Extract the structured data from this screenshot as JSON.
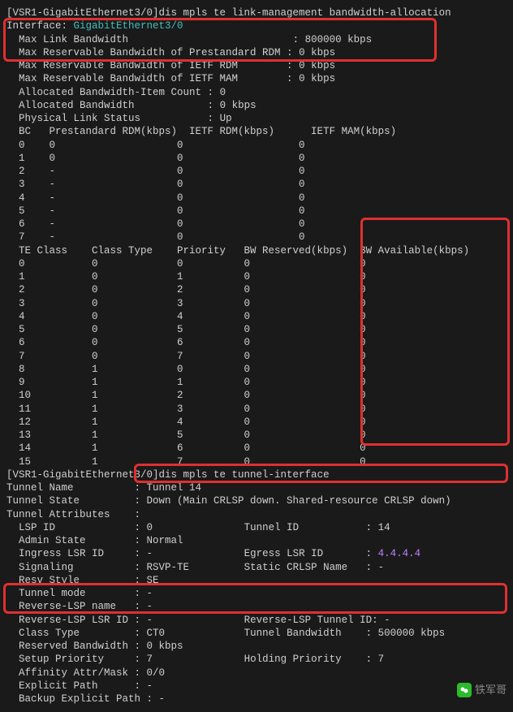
{
  "cmd1_prompt": "[VSR1-GigabitEthernet3/0]",
  "cmd1": "dis mpls te link-management bandwidth-allocation",
  "iface_label": "Interface: ",
  "iface": "GigabitEthernet3/0",
  "max_link_bw_label": "  Max Link Bandwidth",
  "max_link_bw_val": "800000 kbps",
  "max_resv_bw_pre_label": "  Max Reservable Bandwidth of Prestandard RDM",
  "max_resv_bw_pre_val": "0 kbps",
  "max_resv_bw_ietf_rdm_label": "  Max Reservable Bandwidth of IETF RDM",
  "max_resv_bw_ietf_rdm_val": "0 kbps",
  "max_resv_bw_ietf_mam_label": "  Max Reservable Bandwidth of IETF MAM",
  "max_resv_bw_ietf_mam_val": "0 kbps",
  "alloc_bw_item_label": "  Allocated Bandwidth-Item Count",
  "alloc_bw_item_val": "0",
  "alloc_bw_label": "  Allocated Bandwidth",
  "alloc_bw_val": "0 kbps",
  "phys_link_label": "  Physical Link Status",
  "phys_link_val": "Up",
  "bc_hdr": "  BC   Prestandard RDM(kbps)  IETF RDM(kbps)      IETF MAM(kbps)",
  "bc_rows": [
    {
      "c0": "  0    0",
      "c1": "0",
      "c2": "0"
    },
    {
      "c0": "  1    0",
      "c1": "0",
      "c2": "0"
    },
    {
      "c0": "  2    -",
      "c1": "0",
      "c2": "0"
    },
    {
      "c0": "  3    -",
      "c1": "0",
      "c2": "0"
    },
    {
      "c0": "  4    -",
      "c1": "0",
      "c2": "0"
    },
    {
      "c0": "  5    -",
      "c1": "0",
      "c2": "0"
    },
    {
      "c0": "  6    -",
      "c1": "0",
      "c2": "0"
    },
    {
      "c0": "  7    -",
      "c1": "0",
      "c2": "0"
    }
  ],
  "te_hdr": "  TE Class    Class Type    Priority   BW Reserved(kbps)  BW Available(kbps)",
  "te_rows": [
    {
      "c0": "0",
      "c1": "0",
      "c2": "0",
      "c3": "0",
      "c4": "0"
    },
    {
      "c0": "1",
      "c1": "0",
      "c2": "1",
      "c3": "0",
      "c4": "0"
    },
    {
      "c0": "2",
      "c1": "0",
      "c2": "2",
      "c3": "0",
      "c4": "0"
    },
    {
      "c0": "3",
      "c1": "0",
      "c2": "3",
      "c3": "0",
      "c4": "0"
    },
    {
      "c0": "4",
      "c1": "0",
      "c2": "4",
      "c3": "0",
      "c4": "0"
    },
    {
      "c0": "5",
      "c1": "0",
      "c2": "5",
      "c3": "0",
      "c4": "0"
    },
    {
      "c0": "6",
      "c1": "0",
      "c2": "6",
      "c3": "0",
      "c4": "0"
    },
    {
      "c0": "7",
      "c1": "0",
      "c2": "7",
      "c3": "0",
      "c4": "0"
    },
    {
      "c0": "8",
      "c1": "1",
      "c2": "0",
      "c3": "0",
      "c4": "0"
    },
    {
      "c0": "9",
      "c1": "1",
      "c2": "1",
      "c3": "0",
      "c4": "0"
    },
    {
      "c0": "10",
      "c1": "1",
      "c2": "2",
      "c3": "0",
      "c4": "0"
    },
    {
      "c0": "11",
      "c1": "1",
      "c2": "3",
      "c3": "0",
      "c4": "0"
    },
    {
      "c0": "12",
      "c1": "1",
      "c2": "4",
      "c3": "0",
      "c4": "0"
    },
    {
      "c0": "13",
      "c1": "1",
      "c2": "5",
      "c3": "0",
      "c4": "0"
    },
    {
      "c0": "14",
      "c1": "1",
      "c2": "6",
      "c3": "0",
      "c4": "0"
    },
    {
      "c0": "15",
      "c1": "1",
      "c2": "7",
      "c3": "0",
      "c4": "0"
    }
  ],
  "cmd2_prompt": "[VSR1-GigabitEthernet3/0]",
  "cmd2": "dis mpls te tunnel-interface",
  "tun_name_label": "Tunnel Name",
  "tun_name_val": "Tunnel 14",
  "tun_state_label": "Tunnel State",
  "tun_state_val": "Down (Main CRLSP down. Shared-resource CRLSP down)",
  "tun_attr_label": "Tunnel Attributes",
  "lsp_id_label": "  LSP ID",
  "lsp_id_val": "0",
  "tunnel_id_label": "Tunnel ID",
  "tunnel_id_val": "14",
  "admin_state_label": "  Admin State",
  "admin_state_val": "Normal",
  "ingress_lsr_label": "  Ingress LSR ID",
  "ingress_lsr_val": "-",
  "egress_lsr_label": "Egress LSR ID",
  "egress_lsr_val": "4.4.4.4",
  "signaling_label": "  Signaling",
  "signaling_val": "RSVP-TE",
  "static_crlsp_label": "Static CRLSP Name",
  "static_crlsp_val": "-",
  "resv_style_label": "  Resv Style",
  "resv_style_val": "SE",
  "tunnel_mode_label": "  Tunnel mode",
  "tunnel_mode_val": "-",
  "rev_lsp_name_label": "  Reverse-LSP name",
  "rev_lsp_name_val": "-",
  "rev_lsp_lsr_label": "  Reverse-LSP LSR ID",
  "rev_lsp_lsr_val": "-",
  "rev_lsp_tun_label": "Reverse-LSP Tunnel ID",
  "rev_lsp_tun_val": "-",
  "class_type_label": "  Class Type",
  "class_type_val": "CT0",
  "tunnel_bw_label": "Tunnel Bandwidth",
  "tunnel_bw_val": "500000 kbps",
  "reserved_bw_label": "  Reserved Bandwidth",
  "reserved_bw_val": "0 kbps",
  "setup_prio_label": "  Setup Priority",
  "setup_prio_val": "7",
  "holding_prio_label": "Holding Priority",
  "holding_prio_val": "7",
  "affinity_label": "  Affinity Attr/Mask",
  "affinity_val": "0/0",
  "explicit_path_label": "  Explicit Path",
  "explicit_path_val": "-",
  "backup_path_label": "  Backup Explicit Path",
  "backup_path_val": "-",
  "watermark": "铁军哥"
}
